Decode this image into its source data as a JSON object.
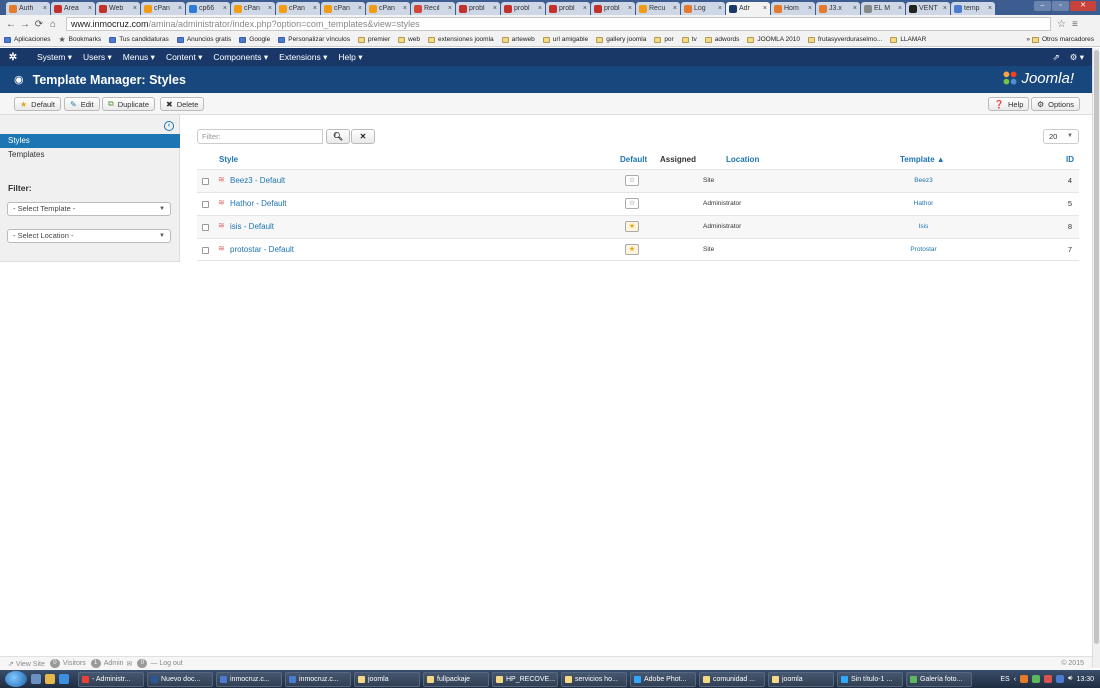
{
  "browser": {
    "tabs": [
      {
        "label": "Auth",
        "color": "#e57b2a"
      },
      {
        "label": "Área",
        "color": "#c4302b"
      },
      {
        "label": "Web",
        "color": "#c4302b"
      },
      {
        "label": "cPan",
        "color": "#f39c12"
      },
      {
        "label": "cp66",
        "color": "#2c7bd6"
      },
      {
        "label": "cPan",
        "color": "#f39c12"
      },
      {
        "label": "cPan",
        "color": "#f39c12"
      },
      {
        "label": "cPan",
        "color": "#f39c12"
      },
      {
        "label": "cPan",
        "color": "#f39c12"
      },
      {
        "label": "Recil",
        "color": "#d44638"
      },
      {
        "label": "probl",
        "color": "#c4302b"
      },
      {
        "label": "probl",
        "color": "#c4302b"
      },
      {
        "label": "probl",
        "color": "#c4302b"
      },
      {
        "label": "probl",
        "color": "#c4302b"
      },
      {
        "label": "Recu",
        "color": "#f39c12"
      },
      {
        "label": "Log",
        "color": "#e57b2a"
      },
      {
        "label": "Adr",
        "color": "#1a3867",
        "active": true
      },
      {
        "label": "Hom",
        "color": "#e57b2a"
      },
      {
        "label": "J3.x",
        "color": "#e57b2a"
      },
      {
        "label": "EL M",
        "color": "#888888"
      },
      {
        "label": "VENT",
        "color": "#222222"
      },
      {
        "label": "temp",
        "color": "#4a7bd1"
      }
    ],
    "tab_close": "×",
    "url_host": "www.inmocruz.com",
    "url_path": "/amina/administrator/index.php?option=com_templates&view=styles",
    "bookmarks": [
      "Aplicaciones",
      "Bookmarks",
      "Tus candidaturas",
      "Anuncios gratis",
      "Google",
      "Personalizar vínculos",
      "premier",
      "web",
      "extensiones joomla",
      "arteweb",
      "url amigable",
      "gallery joomla",
      "por",
      "tv",
      "adwords",
      "JOOMLA 2010",
      "frutasyverduraselmo...",
      "LLAMAR"
    ],
    "bookmarks_more": "»",
    "bookmarks_other": "Otros marcadores"
  },
  "joomla": {
    "menu": [
      "System ▾",
      "Users ▾",
      "Menus ▾",
      "Content ▾",
      "Components ▾",
      "Extensions ▾",
      "Help ▾"
    ],
    "page_title": "Template Manager: Styles",
    "brand": "Joomla!",
    "toolbar": {
      "default_label": "Default",
      "edit_label": "Edit",
      "duplicate_label": "Duplicate",
      "delete_label": "Delete",
      "help_label": "Help",
      "options_label": "Options"
    },
    "sidebar": {
      "styles": "Styles",
      "templates": "Templates",
      "filter_heading": "Filter:",
      "select_template": "- Select Template -",
      "select_location": "- Select Location -"
    },
    "filter_placeholder": "Filter:",
    "list_limit": "20",
    "columns": {
      "style": "Style",
      "default": "Default",
      "assigned": "Assigned",
      "location": "Location",
      "template": "Template ▲",
      "id": "ID"
    },
    "rows": [
      {
        "style": "Beez3 - Default",
        "default": false,
        "location": "Site",
        "template": "Beez3",
        "id": "4"
      },
      {
        "style": "Hathor - Default",
        "default": false,
        "location": "Administrator",
        "template": "Hathor",
        "id": "5"
      },
      {
        "style": "isis - Default",
        "default": true,
        "location": "Administrator",
        "template": "Isis",
        "id": "8"
      },
      {
        "style": "protostar - Default",
        "default": true,
        "location": "Site",
        "template": "Protostar",
        "id": "7"
      }
    ],
    "status": {
      "view_site": "View Site",
      "visitors_count": "0",
      "visitors_label": "Visitors",
      "admin_count": "1",
      "admin_label": "Admin",
      "messages_count": "0",
      "logout": "Log out",
      "copyright": "© 2015"
    }
  },
  "taskbar": {
    "tasks": [
      {
        "label": "- Administr...",
        "color": "#e94235"
      },
      {
        "label": "Nuevo doc...",
        "color": "#2b5797"
      },
      {
        "label": "inmocruz.c...",
        "color": "#4a7bd1"
      },
      {
        "label": "inmocruz.c...",
        "color": "#4a7bd1"
      },
      {
        "label": "joomla",
        "color": "#f3d984"
      },
      {
        "label": "fullpackaje",
        "color": "#f3d984"
      },
      {
        "label": "HP_RECOVE...",
        "color": "#f3d984"
      },
      {
        "label": "servicios ho...",
        "color": "#f3d984"
      },
      {
        "label": "Adobe Phot...",
        "color": "#31a8ff"
      },
      {
        "label": "comunidad ...",
        "color": "#f3d984"
      },
      {
        "label": "joomla",
        "color": "#f3d984"
      },
      {
        "label": "Sin título-1 ...",
        "color": "#31a8ff"
      },
      {
        "label": "Galería foto...",
        "color": "#5cb85c"
      }
    ],
    "lang": "ES",
    "clock": "13:30"
  }
}
